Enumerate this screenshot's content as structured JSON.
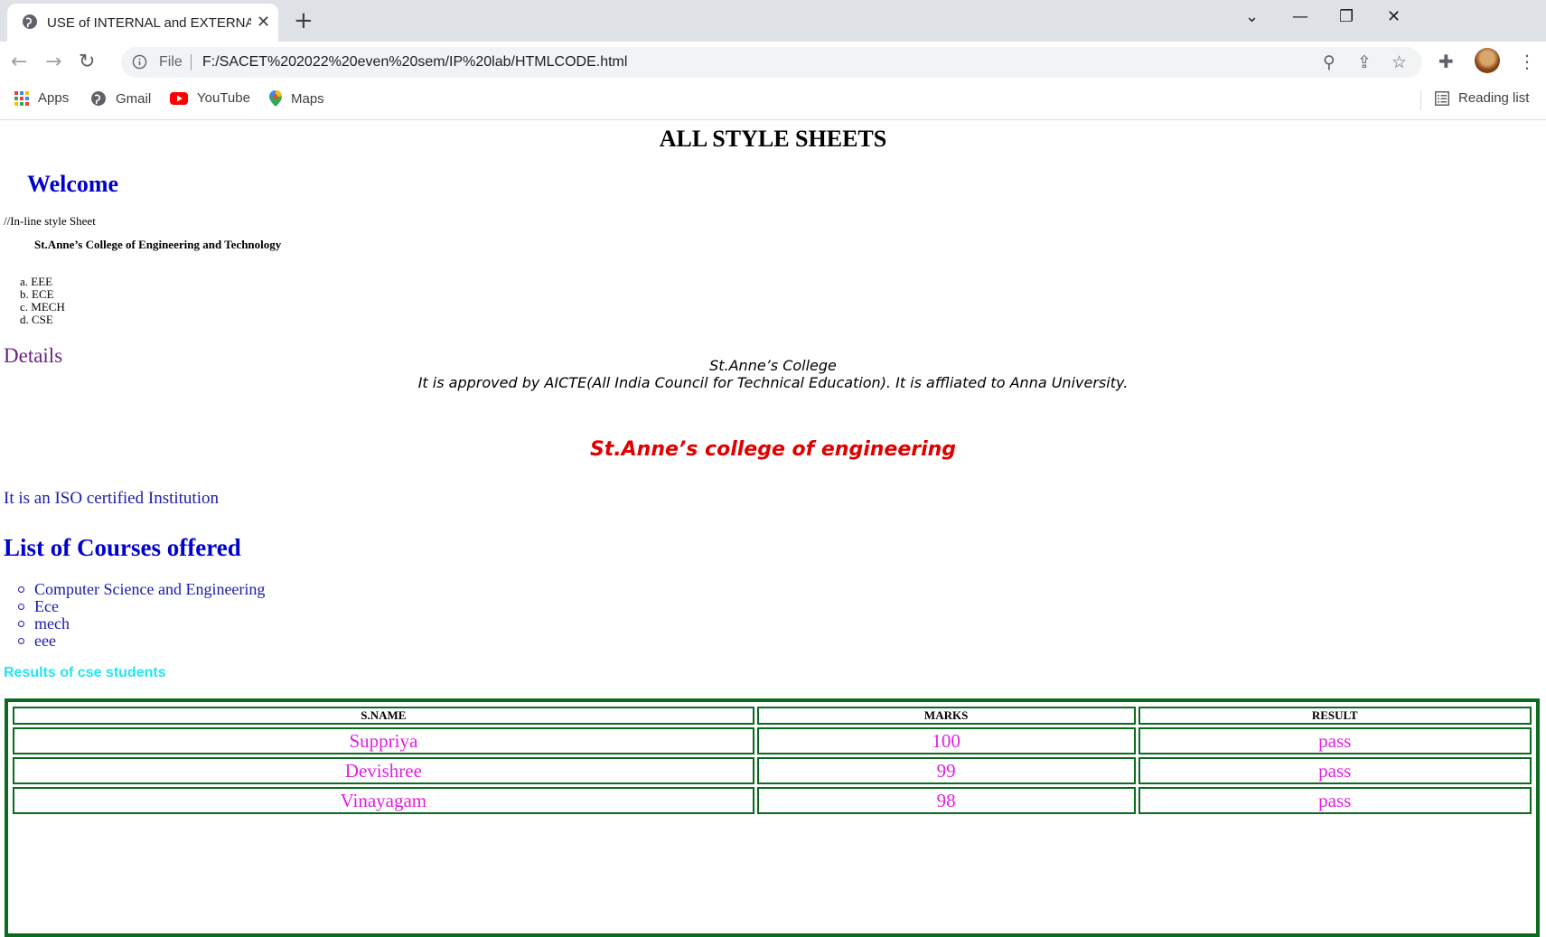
{
  "browser": {
    "tab_title": "USE of INTERNAL and EXTERNAL",
    "new_tab": "+",
    "omnibox_label": "File",
    "url": "F:/SACET%202022%20even%20sem/IP%20lab/HTMLCODE.html",
    "bookmarks": [
      {
        "label": "Apps",
        "icon": "apps-grid-icon"
      },
      {
        "label": "Gmail",
        "icon": "globe-icon"
      },
      {
        "label": "YouTube",
        "icon": "youtube-icon"
      },
      {
        "label": "Maps",
        "icon": "maps-pin-icon"
      }
    ],
    "reading_list": "Reading list"
  },
  "page": {
    "heading": "ALL STYLE SHEETS",
    "welcome": "Welcome",
    "inline_note": "//In-line style Sheet",
    "college_bold": "St.Anne’s College of Engineering and Technology",
    "departments": [
      {
        "marker": "a.",
        "name": "EEE"
      },
      {
        "marker": "b.",
        "name": "ECE"
      },
      {
        "marker": "c.",
        "name": "MECH"
      },
      {
        "marker": "d.",
        "name": "CSE"
      }
    ],
    "details_heading": "Details",
    "details_line1": "St.Anne’s College",
    "details_line2": "It is approved by AICTE(All India Council for Technical Education). It is affliated to Anna University.",
    "college_red": "St.Anne’s college of engineering",
    "iso_text": "It is an ISO certified Institution",
    "courses_heading": "List of Courses offered",
    "courses": [
      "Computer Science and Engineering",
      "Ece",
      "mech",
      "eee"
    ],
    "results_heading": "Results of cse students",
    "table": {
      "headers": [
        "S.NAME",
        "MARKS",
        "RESULT"
      ],
      "rows": [
        [
          "Suppriya",
          "100",
          "pass"
        ],
        [
          "Devishree",
          "99",
          "pass"
        ],
        [
          "Vinayagam",
          "98",
          "pass"
        ]
      ]
    }
  },
  "colors": {
    "welcome": "#0000cd",
    "details": "#6b1f7e",
    "college_red": "#e00000",
    "results_heading": "#22e6f0",
    "table_border": "#0a6a1e",
    "table_cells": "#e020e0"
  }
}
